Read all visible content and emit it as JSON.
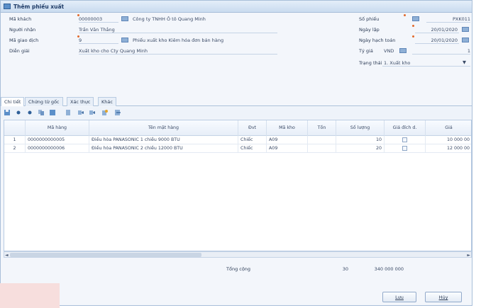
{
  "window": {
    "title": "Thêm phiếu xuất"
  },
  "header_left": [
    {
      "label": "Mã khách",
      "code": "00000003",
      "text": "Công ty TNHH Ô tô Quang Minh"
    },
    {
      "label": "Người nhận",
      "code": "Trần Văn Thắng",
      "text": ""
    },
    {
      "label": "Mã giao dịch",
      "code": "9",
      "text": "Phiếu xuất kho Kiêm hóa đơn bán hàng"
    },
    {
      "label": "Diễn giải",
      "code": "Xuất kho cho Cty Quang Minh",
      "text": ""
    }
  ],
  "header_right": [
    {
      "label": "Số phiếu",
      "value": "PXK011"
    },
    {
      "label": "Ngày lập",
      "value": "20/01/2020"
    },
    {
      "label": "Ngày hạch toán",
      "value": "20/01/2020"
    },
    {
      "label": "Tỷ giá",
      "currency": "VND",
      "value": "1"
    },
    {
      "label": "Trạng thái",
      "value": "1. Xuất kho"
    }
  ],
  "tabs": [
    {
      "label": "Chi tiết",
      "active": true
    },
    {
      "label": "Chứng từ gốc",
      "active": false
    },
    {
      "label": "Xác thực",
      "active": false
    },
    {
      "label": "Khác",
      "active": false
    }
  ],
  "toolbar_icons": [
    "save-icon",
    "add-icon",
    "insert-icon",
    "copy-icon",
    "delete-icon",
    "paste-icon",
    "move-up-icon",
    "move-down-icon",
    "attach-icon",
    "export-icon"
  ],
  "grid": {
    "columns": [
      "Mã hàng",
      "Tên mặt hàng",
      "Đvt",
      "Mã kho",
      "Tồn",
      "Số lượng",
      "Giá đích d.",
      "Giá"
    ],
    "rows": [
      {
        "num": "1",
        "ma_hang": "0000000000005",
        "ten": "Điều hòa PANASONIC 1 chiều 9000 BTU",
        "dvt": "Chiếc",
        "ma_kho": "A09",
        "ton": "",
        "so_luong": "10",
        "gia": "10 000 00"
      },
      {
        "num": "2",
        "ma_hang": "0000000000006",
        "ten": "Điều hòa PANASONIC 2 chiều 12000 BTU",
        "dvt": "Chiếc",
        "ma_kho": "A09",
        "ton": "",
        "so_luong": "20",
        "gia": "12 000 00"
      }
    ]
  },
  "totals": {
    "label": "Tổng cộng",
    "quantity": "30",
    "amount": "340 000 000"
  },
  "buttons": {
    "save": "Lưu",
    "cancel": "Hủy"
  },
  "colors": {
    "accent": "#5b8fc9",
    "border": "#a9bfd9",
    "required": "#e26a2c"
  }
}
